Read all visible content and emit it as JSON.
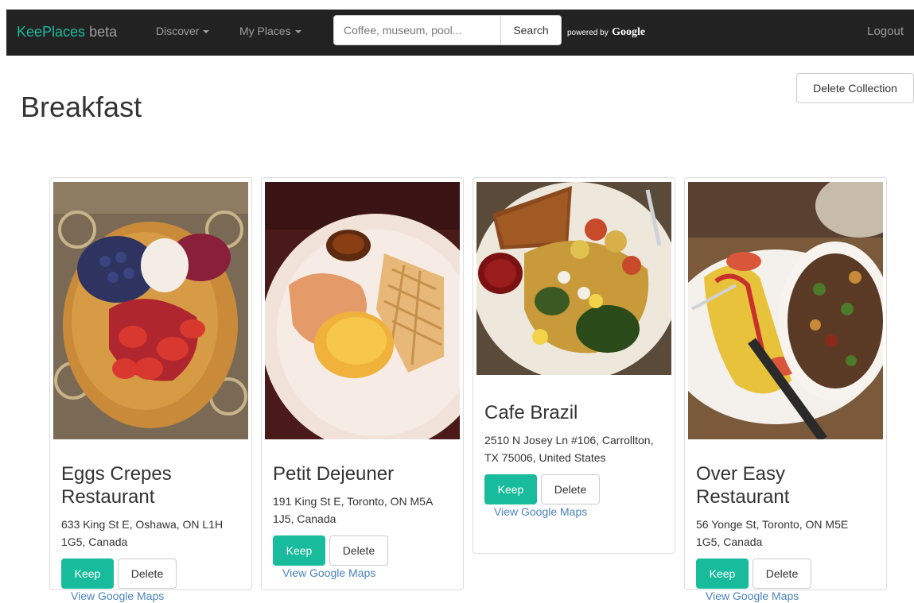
{
  "navbar": {
    "brand_name": "KeePlaces",
    "brand_tag": "beta",
    "discover_label": "Discover",
    "my_places_label": "My Places",
    "search_placeholder": "Coffee, museum, pool...",
    "search_button": "Search",
    "powered_by": "powered by",
    "powered_brand": "Google",
    "logout_label": "Logout",
    "brand_color": "#18bc9c",
    "bar_color": "#222222"
  },
  "page": {
    "title": "Breakfast",
    "delete_collection_label": "Delete Collection"
  },
  "cards": [
    {
      "name": "Eggs Crepes Restaurant",
      "address": "633 King St E, Oshawa, ON L1H 1G5, Canada",
      "keep_label": "Keep",
      "delete_label": "Delete",
      "maps_label": "View Google Maps"
    },
    {
      "name": "Petit Dejeuner",
      "address": "191 King St E, Toronto, ON M5A 1J5, Canada",
      "keep_label": "Keep",
      "delete_label": "Delete",
      "maps_label": "View Google Maps"
    },
    {
      "name": "Cafe Brazil",
      "address": "2510 N Josey Ln #106, Carrollton, TX 75006, United States",
      "keep_label": "Keep",
      "delete_label": "Delete",
      "maps_label": "View Google Maps"
    },
    {
      "name": "Over Easy Restaurant",
      "address": "56 Yonge St, Toronto, ON M5E 1G5, Canada",
      "keep_label": "Keep",
      "delete_label": "Delete",
      "maps_label": "View Google Maps"
    }
  ]
}
